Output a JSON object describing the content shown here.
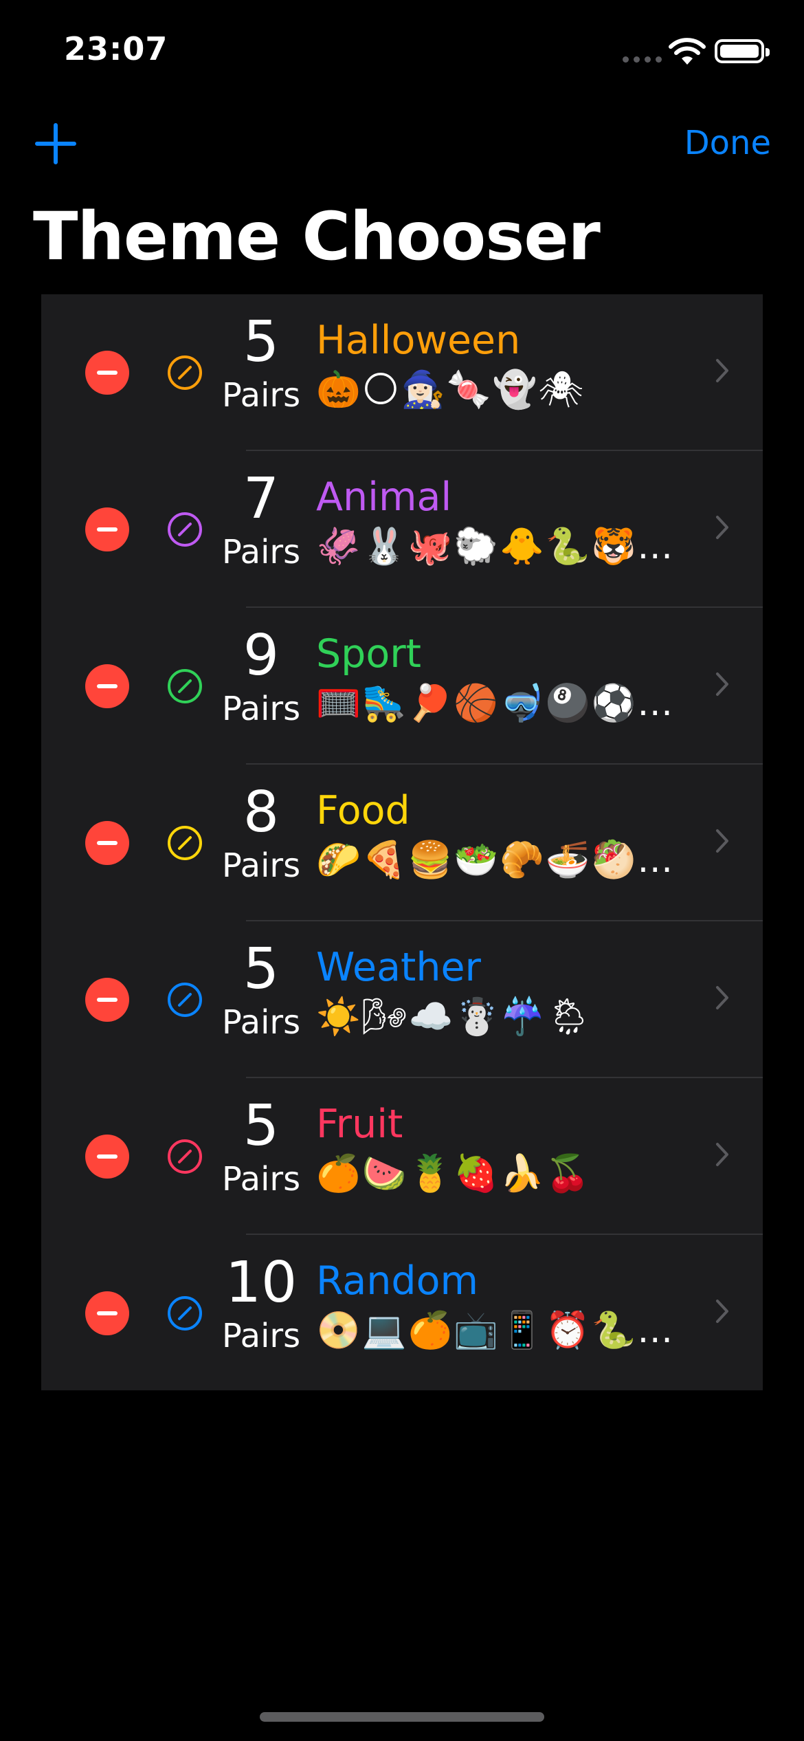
{
  "status_bar": {
    "time": "23:07"
  },
  "nav": {
    "done_label": "Done"
  },
  "title": "Theme Chooser",
  "colors": {
    "accent": "#0a84ff",
    "delete": "#ff453a",
    "background": "#000000",
    "row_background": "#1c1c1e"
  },
  "pairs_label": "Pairs",
  "themes": [
    {
      "name": "Halloween",
      "pairs": "5",
      "emojis": "🎃🌕🧙🏻‍♀️🍬👻🕷",
      "color": "#ff9f0a"
    },
    {
      "name": "Animal",
      "pairs": "7",
      "emojis": "🦑🐰🐙🐑🐥🐍🐯…",
      "color": "#bf5af2"
    },
    {
      "name": "Sport",
      "pairs": "9",
      "emojis": "🥅🛼🏓🏀🤿🎱⚽️…",
      "color": "#30d158"
    },
    {
      "name": "Food",
      "pairs": "8",
      "emojis": "🌮🍕🍔🥗🥐🍜🥙…",
      "color": "#ffd60a"
    },
    {
      "name": "Weather",
      "pairs": "5",
      "emojis": "☀️🌬☁️☃️☔️🌦",
      "color": "#0a84ff"
    },
    {
      "name": "Fruit",
      "pairs": "5",
      "emojis": "🍊🍉🍍🍓🍌🍒",
      "color": "#ff375f"
    },
    {
      "name": "Random",
      "pairs": "10",
      "emojis": "📀💻🍊📺📱⏰🐍…",
      "color": "#0a84ff"
    }
  ]
}
